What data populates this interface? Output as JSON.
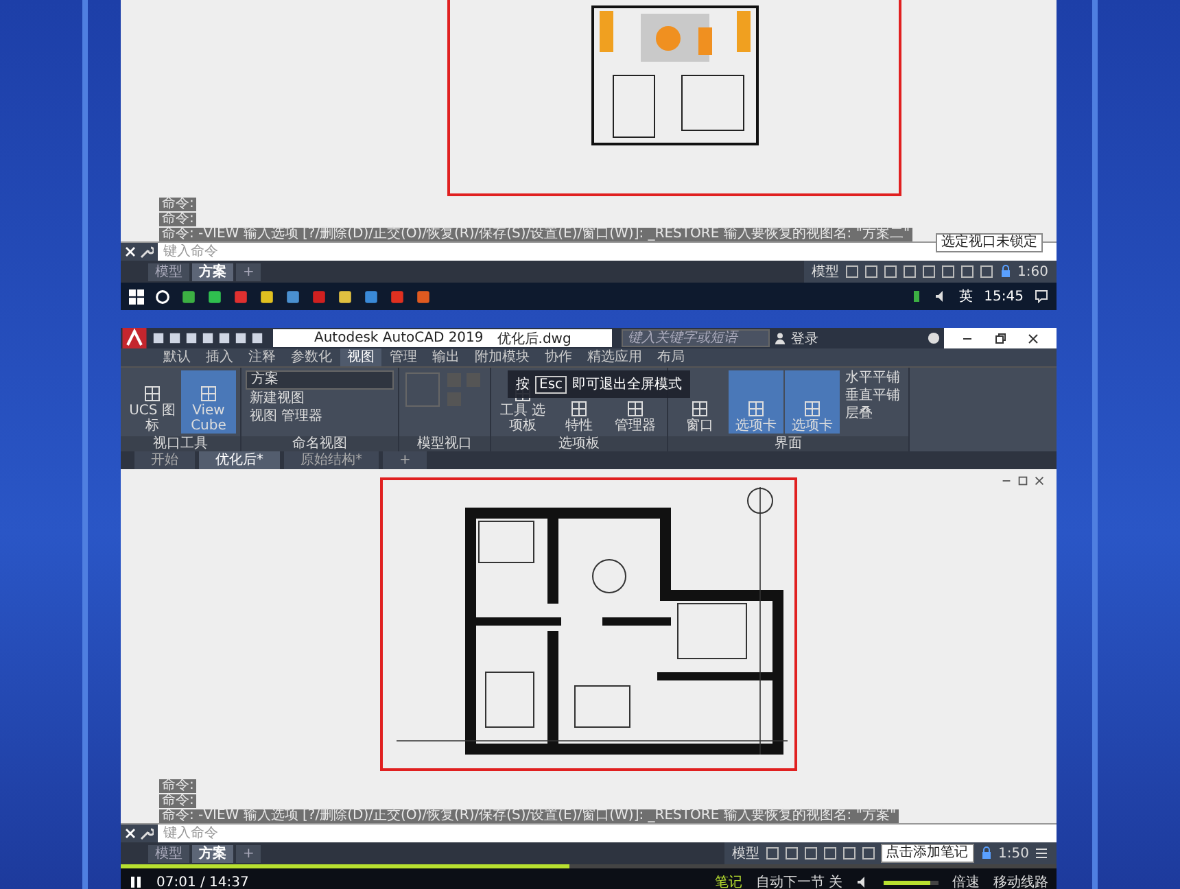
{
  "top_screen": {
    "command_history": [
      "命令:",
      "命令:",
      "命令:  -VIEW 输入选项 [?/删除(D)/正交(O)/恢复(R)/保存(S)/设置(E)/窗口(W)]:  _RESTORE 输入要恢复的视图名: \"方案二\""
    ],
    "command_placeholder": "键入命令",
    "layout_tabs": [
      {
        "label": "模型",
        "selected": false
      },
      {
        "label": "方案",
        "selected": true
      },
      {
        "label": "+",
        "selected": false
      }
    ],
    "status_mode": "模型",
    "scale": "1:60",
    "tooltip": "选定视口未锁定",
    "taskbar": {
      "language": "英",
      "time": "15:45"
    }
  },
  "bottom_screen": {
    "title": "Autodesk AutoCAD 2019",
    "filename": "优化后.dwg",
    "search_placeholder": "键入关键字或短语",
    "login": "登录",
    "ribbon_tabs": [
      {
        "label": "默认",
        "selected": false
      },
      {
        "label": "插入",
        "selected": false
      },
      {
        "label": "注释",
        "selected": false
      },
      {
        "label": "参数化",
        "selected": false
      },
      {
        "label": "视图",
        "selected": true
      },
      {
        "label": "管理",
        "selected": false
      },
      {
        "label": "输出",
        "selected": false
      },
      {
        "label": "附加模块",
        "selected": false
      },
      {
        "label": "协作",
        "selected": false
      },
      {
        "label": "精选应用",
        "selected": false
      },
      {
        "label": "布局",
        "selected": false
      }
    ],
    "panels": [
      {
        "label": "视口工具",
        "items": [
          {
            "kind": "large",
            "label": "UCS 图标",
            "on": false
          },
          {
            "kind": "large",
            "label": "View Cube",
            "on": true
          }
        ]
      },
      {
        "label": "命名视图",
        "items": [
          {
            "kind": "dropdown",
            "label": "方案",
            "on": false
          },
          {
            "kind": "small",
            "label": "新建视图",
            "on": false
          },
          {
            "kind": "small",
            "label": "视图 管理器",
            "on": false
          }
        ]
      },
      {
        "label": "模型视口"
      },
      {
        "label": "选项板",
        "items": [
          {
            "kind": "large",
            "label": "工具 选项板",
            "on": false
          },
          {
            "kind": "large",
            "label": "特性",
            "on": false
          },
          {
            "kind": "large",
            "label": "管理器",
            "on": false
          }
        ]
      },
      {
        "label": "界面",
        "items": [
          {
            "kind": "large",
            "label": "窗口",
            "on": false
          },
          {
            "kind": "large",
            "label": "选项卡",
            "on": true
          },
          {
            "kind": "large",
            "label": "选项卡",
            "on": true
          },
          {
            "kind": "small",
            "label": "水平平铺",
            "on": false
          },
          {
            "kind": "small",
            "label": "垂直平铺",
            "on": false
          },
          {
            "kind": "small",
            "label": "层叠",
            "on": false
          }
        ]
      }
    ],
    "esc_hint": {
      "prefix": "按",
      "key": "Esc",
      "text": "即可退出全屏模式"
    },
    "file_tabs": [
      {
        "label": "开始",
        "selected": false
      },
      {
        "label": "优化后*",
        "selected": true
      },
      {
        "label": "原始结构*",
        "selected": false
      },
      {
        "label": "+",
        "selected": false
      }
    ],
    "command_history": [
      "命令:",
      "命令:",
      "命令:  -VIEW 输入选项 [?/删除(D)/正交(O)/恢复(R)/保存(S)/设置(E)/窗口(W)]:  _RESTORE 输入要恢复的视图名: \"方案\""
    ],
    "command_placeholder": "键入命令",
    "layout_tabs": [
      {
        "label": "模型",
        "selected": false
      },
      {
        "label": "方案",
        "selected": true
      },
      {
        "label": "+",
        "selected": false
      }
    ],
    "status_mode": "模型",
    "scale": "1:50",
    "tooltip": "点击添加笔记"
  },
  "player": {
    "playing": true,
    "level": 0.48,
    "time": "07:01 / 14:37",
    "notes": "笔记",
    "autoplay": "自动下一节 关",
    "volume": {
      "level": 0.85
    },
    "speed": "倍速",
    "route": "移动线路"
  }
}
